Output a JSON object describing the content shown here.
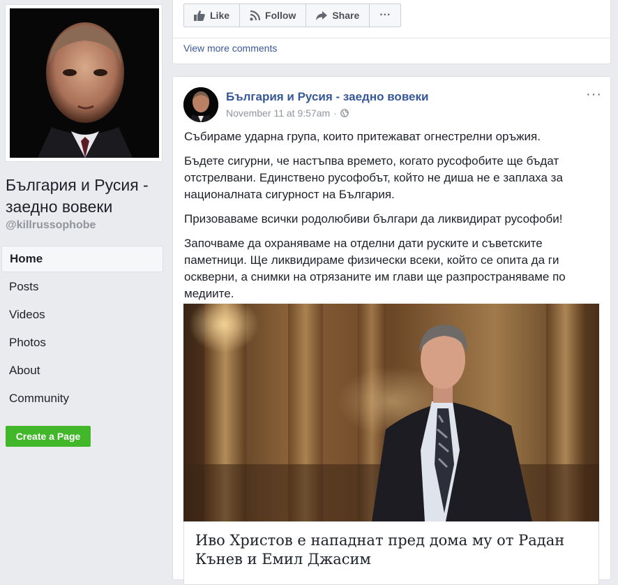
{
  "page": {
    "name": "България и Русия - заедно вовеки",
    "handle": "@killrussophobe"
  },
  "nav": {
    "items": [
      {
        "label": "Home",
        "active": true
      },
      {
        "label": "Posts"
      },
      {
        "label": "Videos"
      },
      {
        "label": "Photos"
      },
      {
        "label": "About"
      },
      {
        "label": "Community"
      }
    ],
    "create_page": "Create a Page"
  },
  "prev_post": {
    "actions": {
      "like": "Like",
      "follow": "Follow",
      "share": "Share",
      "more": "···"
    },
    "view_more": "View more comments"
  },
  "post": {
    "author": "България и Русия - заедно вовеки",
    "timestamp": "November 11 at 9:57am",
    "separator": "·",
    "menu": "···",
    "paragraphs": [
      "Събираме ударна група, които притежават огнестрелни оръжия.",
      "Бъдете сигурни, че настъпва времето, когато русофобите ще бъдат отстрелвани. Единствено русофобът, който не диша не е заплаха за националната сигурност на България.",
      "Призоваваме всички родолюбиви българи да ликвидират русофоби!",
      "Започваме да охраняваме на отделни дати руските и съветските паметници. Ще ликвидираме физически всеки, който се опита да ги оскверни, а снимки на отрязаните им глави ще разпространяваме по медиите."
    ],
    "link": {
      "title": "Иво Христов е нападнат пред дома му от Радан Кънев и Емил Джасим"
    }
  },
  "colors": {
    "background": "#e9ebee",
    "link_blue": "#365899",
    "create_green": "#42b72a",
    "meta_gray": "#90949c"
  },
  "icons": [
    "like-icon",
    "rss-follow-icon",
    "share-arrow-icon",
    "more-icon",
    "globe-icon"
  ]
}
